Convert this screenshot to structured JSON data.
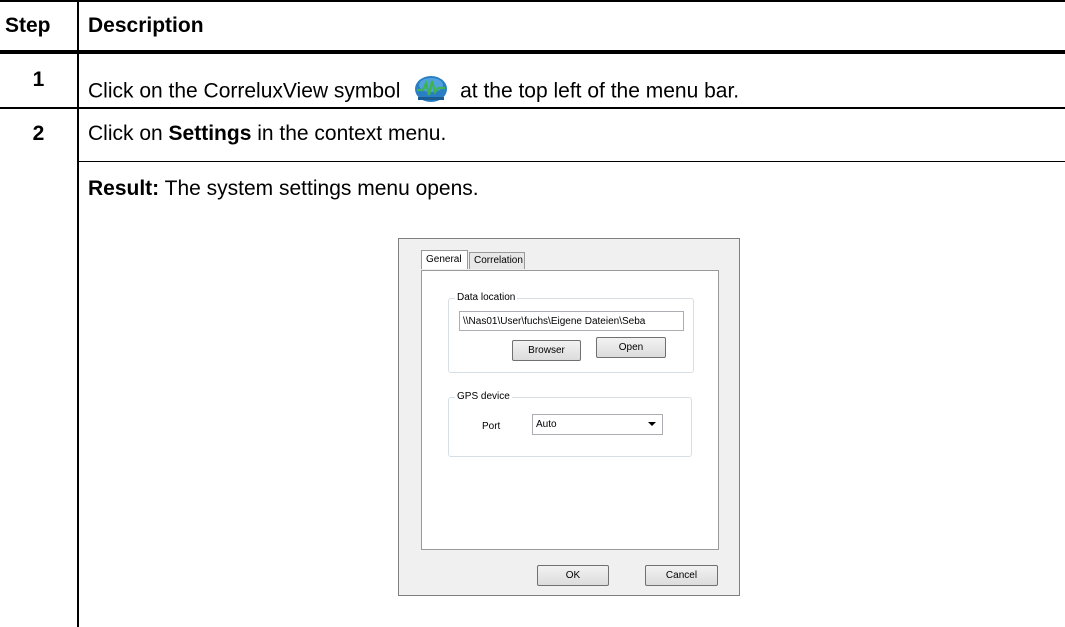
{
  "table": {
    "header": {
      "step": "Step",
      "description": "Description"
    },
    "rows": [
      {
        "step": "1",
        "text_before": "Click on the CorreluxView symbol",
        "icon": "correluxview-icon",
        "text_after": "at the top left of the menu bar."
      },
      {
        "step": "2",
        "text_before": "Click on ",
        "bold": "Settings",
        "text_after": " in the context menu."
      },
      {
        "step": "",
        "bold": "Result:",
        "text_after": " The system settings menu opens."
      }
    ]
  },
  "dialog": {
    "tabs": [
      "General",
      "Correlation"
    ],
    "active_tab": "General",
    "data_location": {
      "title": "Data location",
      "path": "\\\\Nas01\\User\\fuchs\\Eigene Dateien\\Seba",
      "browser_label": "Browser",
      "open_label": "Open"
    },
    "gps_device": {
      "title": "GPS device",
      "port_label": "Port",
      "port_value": "Auto"
    },
    "ok_label": "OK",
    "cancel_label": "Cancel"
  },
  "colors": {
    "icon_blue": "#2a7fc4",
    "icon_wave": "#3fb34f",
    "rule": "#000000"
  }
}
